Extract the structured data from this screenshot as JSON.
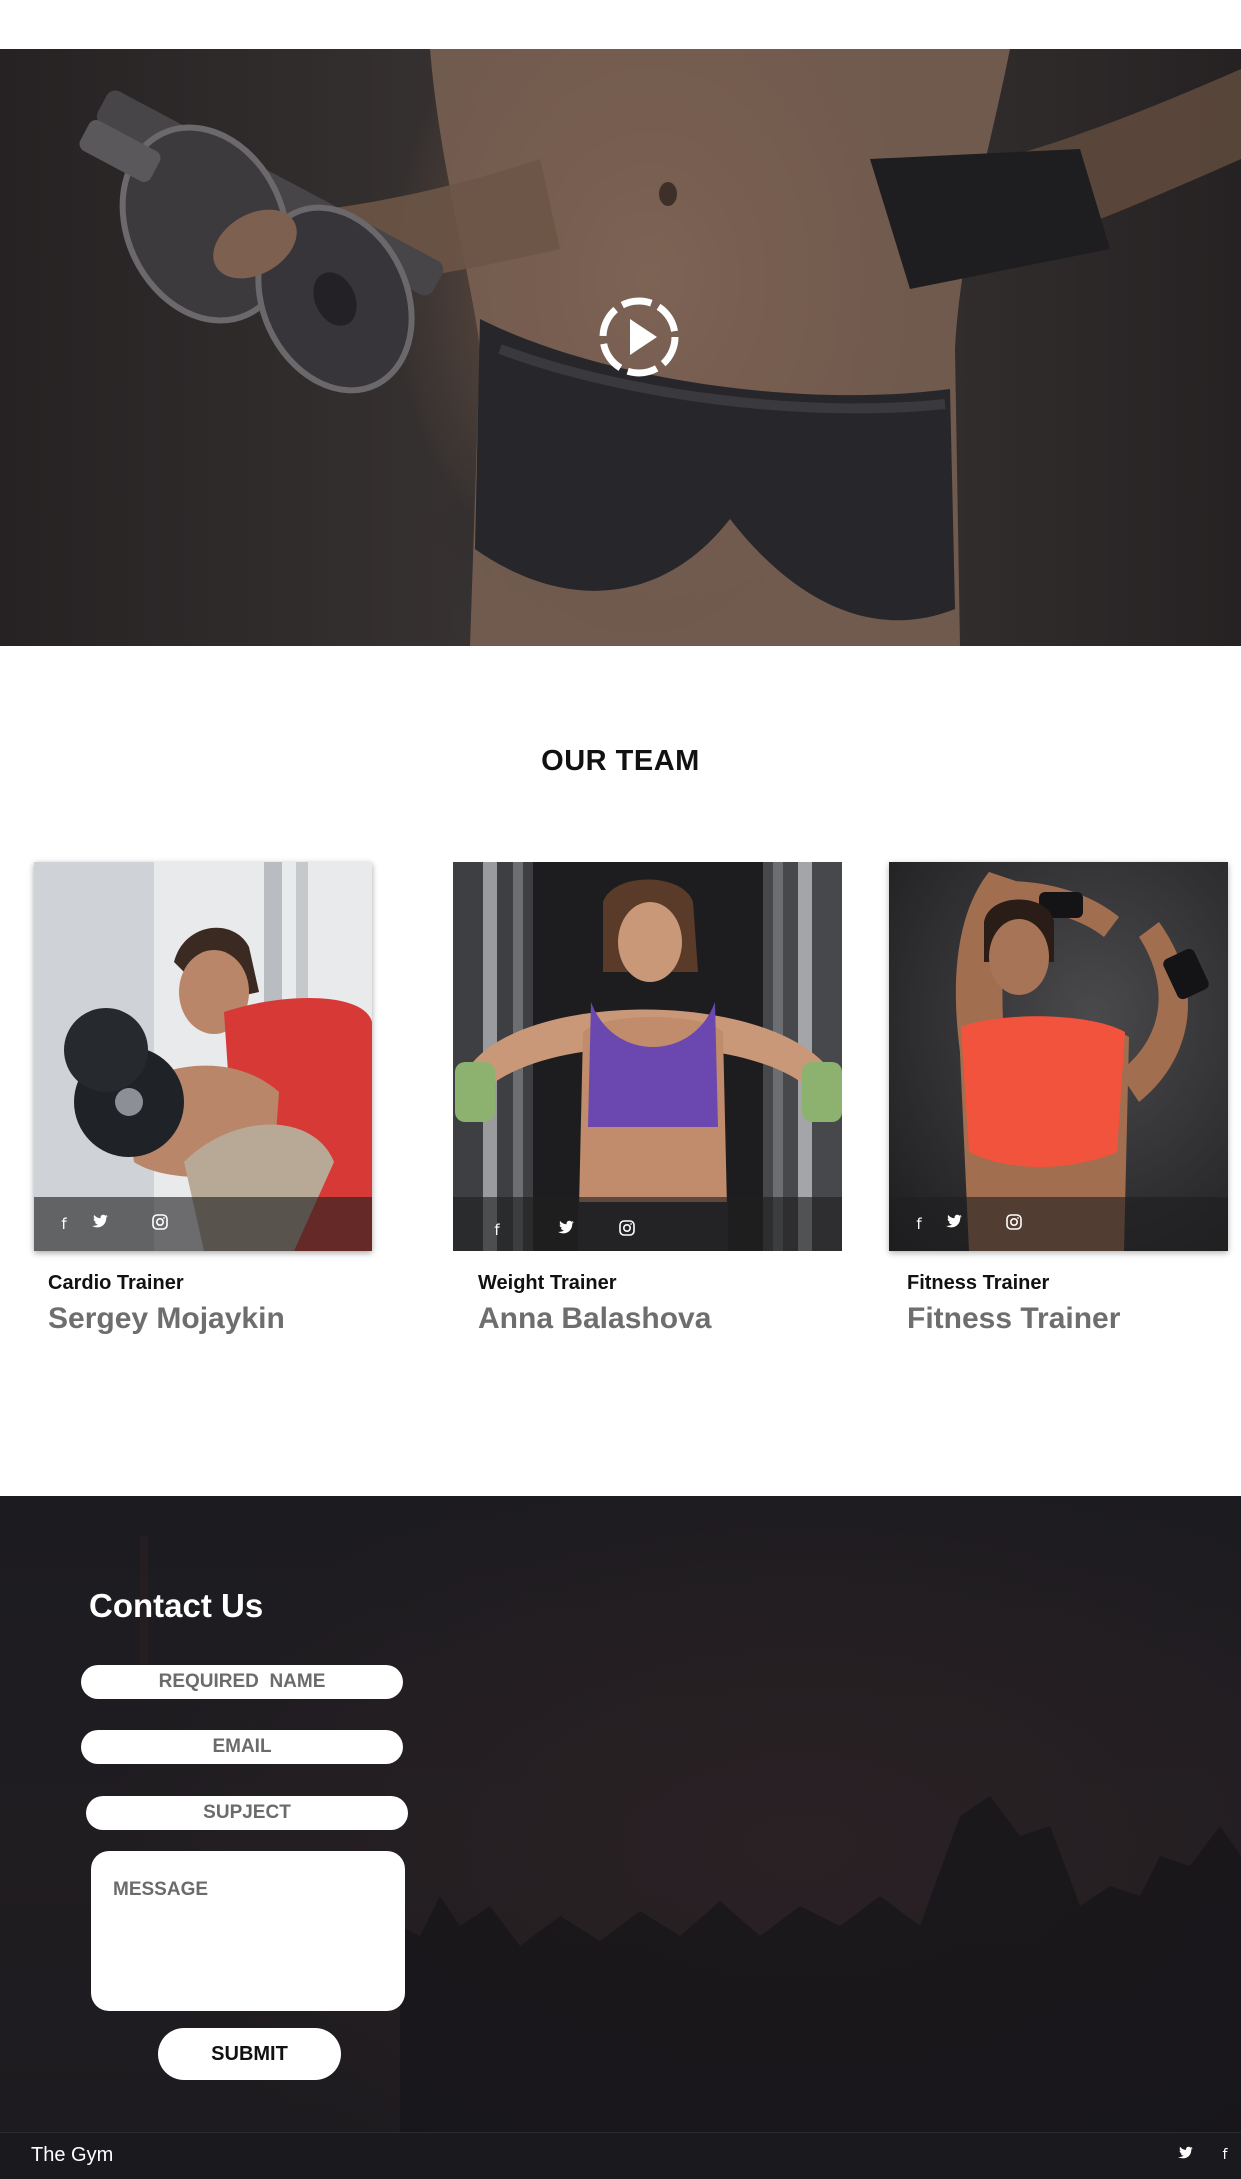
{
  "hero": {
    "play_icon": "play-circle-icon"
  },
  "team": {
    "title": "OUR TEAM",
    "members": [
      {
        "role": "Cardio Trainer",
        "name": "Sergey Mojaykin",
        "social": [
          "facebook-icon",
          "twitter-icon",
          "instagram-icon"
        ]
      },
      {
        "role": "Weight Trainer",
        "name": "Anna Balashova",
        "social": [
          "facebook-icon",
          "twitter-icon",
          "instagram-icon"
        ]
      },
      {
        "role": "Fitness Trainer",
        "name": "Fitness Trainer",
        "social": [
          "facebook-icon",
          "twitter-icon",
          "instagram-icon"
        ]
      }
    ]
  },
  "contact": {
    "title": "Contact Us",
    "name_placeholder": "REQUIRED  NAME",
    "email_placeholder": "EMAIL",
    "subject_placeholder": "SUPJECT",
    "message_placeholder": "MESSAGE",
    "submit_label": "SUBMIT"
  },
  "footer": {
    "brand": "The Gym",
    "social": [
      "twitter-icon",
      "facebook-icon"
    ]
  },
  "colors": {
    "contact_bg": "#1c1b20",
    "footer_bg": "#1a191d",
    "name_text": "#6e6e6e"
  }
}
